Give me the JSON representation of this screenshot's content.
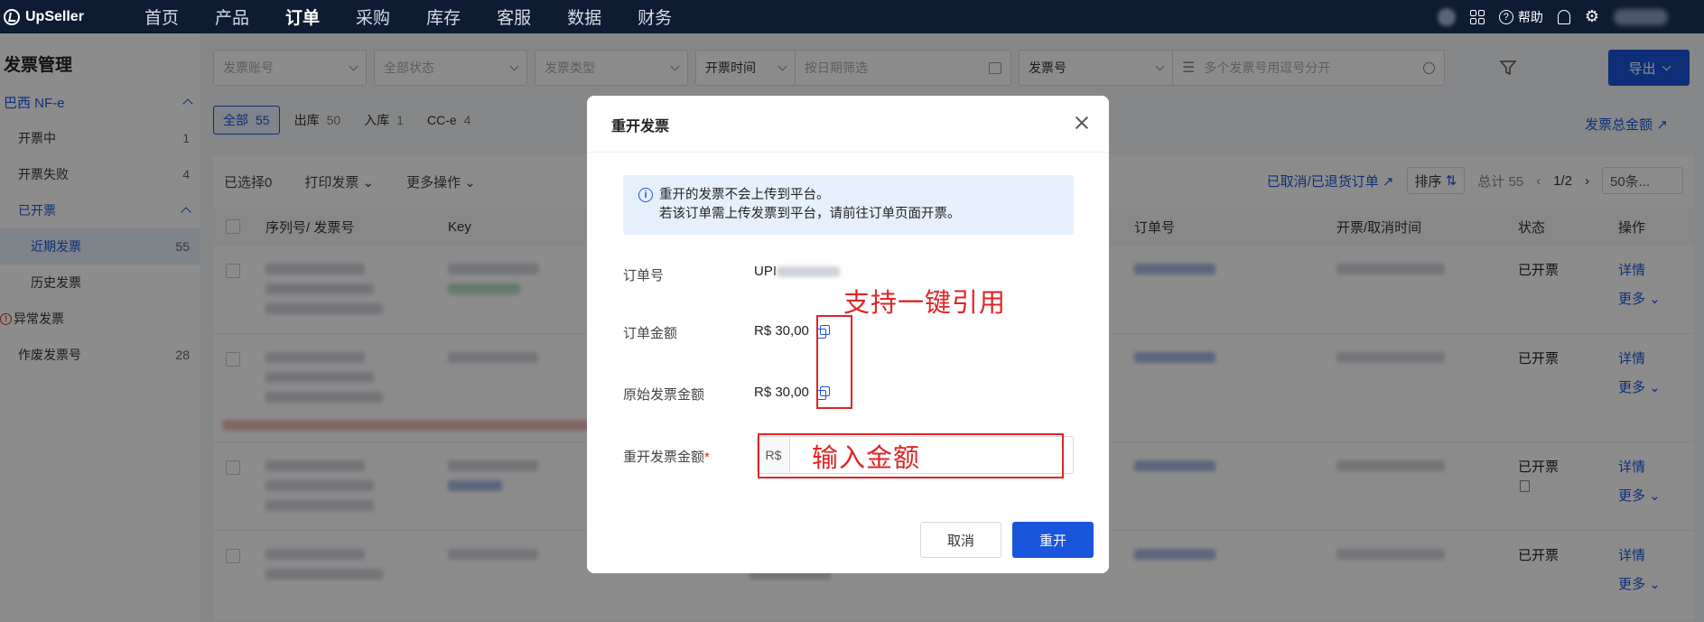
{
  "topnav": {
    "brand": "UpSeller",
    "items": [
      "首页",
      "产品",
      "订单",
      "采购",
      "库存",
      "客服",
      "数据",
      "财务"
    ],
    "active_index": 2,
    "help_label": "帮助"
  },
  "sidebar": {
    "title": "发票管理",
    "group": "巴西 NF-e",
    "items": [
      {
        "label": "开票中",
        "count": "1"
      },
      {
        "label": "开票失败",
        "count": "4"
      },
      {
        "label": "已开票",
        "count": ""
      },
      {
        "label": "近期发票",
        "count": "55"
      },
      {
        "label": "历史发票",
        "count": ""
      },
      {
        "label": "异常发票",
        "count": ""
      },
      {
        "label": "作废发票号",
        "count": "28"
      }
    ]
  },
  "filters": {
    "invoice_account_placeholder": "发票账号",
    "status_placeholder": "全部状态",
    "type_placeholder": "发票类型",
    "time_select": "开票时间",
    "date_placeholder": "按日期筛选",
    "number_select": "发票号",
    "numbers_placeholder": "多个发票号用逗号分开",
    "export_label": "导出"
  },
  "tabs": [
    {
      "label": "全部",
      "count": "55"
    },
    {
      "label": "出库",
      "count": "50"
    },
    {
      "label": "入库",
      "count": "1"
    },
    {
      "label": "CC-e",
      "count": "4"
    }
  ],
  "total_amount_link": "发票总金额",
  "toolbar": {
    "selected": "已选择0",
    "print": "打印发票",
    "more_ops": "更多操作",
    "cancelled_link": "已取消/已退货订单",
    "sort": "排序",
    "total": "总计 55",
    "page": "1/2",
    "per_page": "50条..."
  },
  "table": {
    "headers": {
      "serial": "序列号/ 发票号",
      "key": "Key",
      "order": "订单号",
      "time": "开票/取消时间",
      "status": "状态",
      "ops": "操作"
    },
    "rows": [
      {
        "status": "已开票",
        "op1": "详情",
        "op2": "更多"
      },
      {
        "status": "已开票",
        "op1": "详情",
        "op2": "更多"
      },
      {
        "status": "已开票",
        "op1": "详情",
        "op2": "更多"
      },
      {
        "status": "已开票",
        "op1": "详情",
        "op2": "更多"
      }
    ]
  },
  "modal": {
    "title": "重开发票",
    "info_line1": "重开的发票不会上传到平台。",
    "info_line2": "若该订单需上传发票到平台，请前往订单页面开票。",
    "order_no_label": "订单号",
    "order_no_value": "UPI",
    "order_amount_label": "订单金额",
    "order_amount_value": "R$ 30,00",
    "original_amount_label": "原始发票金额",
    "original_amount_value": "R$ 30,00",
    "reopen_amount_label": "重开发票金额",
    "currency_prefix": "R$",
    "cancel_label": "取消",
    "confirm_label": "重开"
  },
  "annotations": {
    "copy_hint": "支持一键引用",
    "input_hint": "输入金额"
  },
  "colors": {
    "accent": "#1a56db",
    "nav_bg": "#0d1b33",
    "annotation": "#e02424"
  }
}
